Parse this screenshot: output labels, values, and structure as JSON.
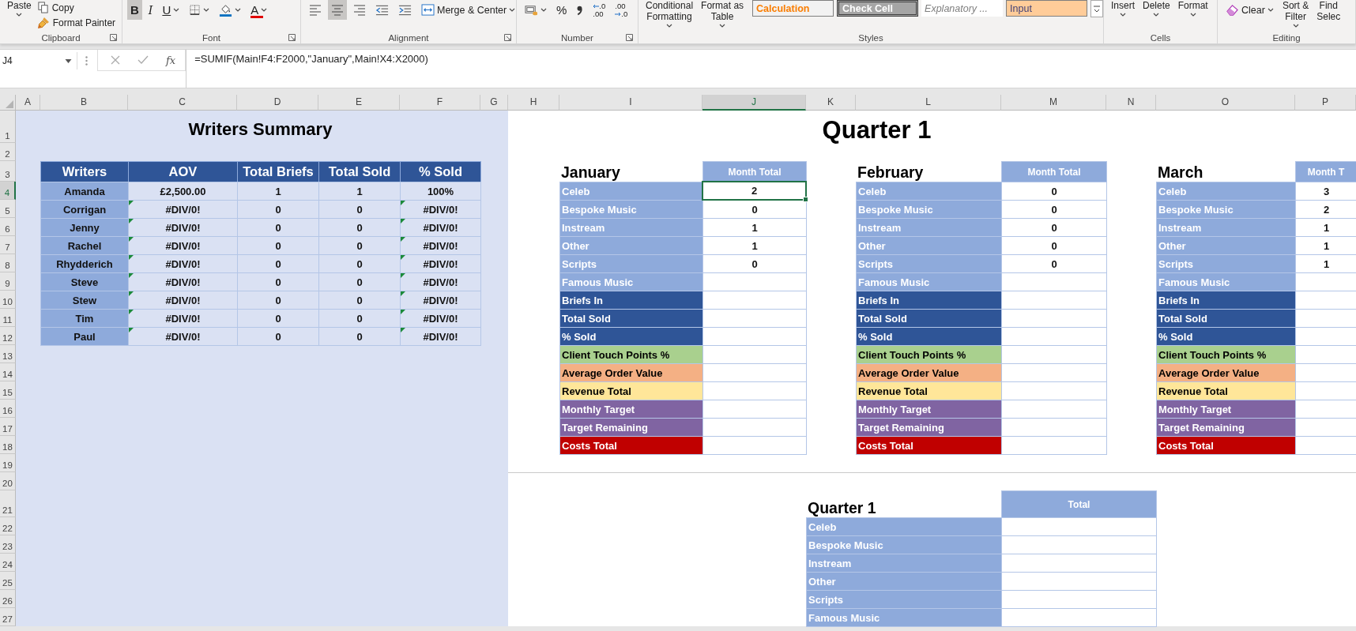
{
  "ribbon": {
    "groups": [
      {
        "label": "Clipboard",
        "items": [
          {
            "kind": "big",
            "lines": [
              "Paste"
            ]
          },
          {
            "kind": "stack",
            "entries": [
              {
                "label": "Copy"
              },
              {
                "label": "Format Painter"
              }
            ]
          }
        ]
      },
      {
        "label": "Font",
        "items": [
          {
            "kind": "tool",
            "glyph": "B",
            "pressed": true
          },
          {
            "kind": "tool",
            "glyph": "I",
            "pressed": false
          },
          {
            "kind": "tool",
            "glyph": "U",
            "pressed": false
          },
          {
            "kind": "tool",
            "pressed": false
          },
          {
            "kind": "tool",
            "pressed": false
          },
          {
            "kind": "tool",
            "glyph": "A",
            "pressed": false
          }
        ]
      },
      {
        "label": "Alignment",
        "items": [
          {
            "kind": "tool",
            "pressed": false
          },
          {
            "kind": "tool",
            "pressed": true
          },
          {
            "kind": "tool",
            "pressed": false
          },
          {
            "kind": "tool",
            "pressed": false
          },
          {
            "kind": "tool",
            "pressed": false
          },
          {
            "kind": "tool",
            "label": "Merge & Center",
            "pressed": false
          }
        ]
      },
      {
        "label": "Number",
        "items": [
          {
            "kind": "tool",
            "pressed": false
          },
          {
            "kind": "tool",
            "glyph": "%",
            "pressed": false
          },
          {
            "kind": "tool",
            "pressed": false
          },
          {
            "kind": "decimal",
            "lines": [
              ".0",
              ".00"
            ]
          },
          {
            "kind": "decimal",
            "lines": [
              ".00",
              ".0"
            ]
          }
        ]
      },
      {
        "label": "Styles",
        "items": [
          {
            "kind": "big",
            "lines": [
              "Conditional",
              "Formatting"
            ]
          },
          {
            "kind": "big",
            "lines": [
              "Format as",
              "Table"
            ]
          },
          {
            "kind": "gallery",
            "cells": [
              "Calculation",
              "Check Cell",
              "Explanatory ...",
              "Input"
            ]
          }
        ]
      },
      {
        "label": "Cells",
        "items": [
          {
            "kind": "big",
            "lines": [
              "Insert"
            ]
          },
          {
            "kind": "big",
            "lines": [
              "Delete"
            ]
          },
          {
            "kind": "big",
            "lines": [
              "Format"
            ]
          }
        ]
      },
      {
        "label": "Editing",
        "items": [
          {
            "kind": "tool",
            "label": "Clear",
            "pressed": false
          },
          {
            "kind": "big",
            "lines": [
              "Sort &",
              "Filter"
            ]
          },
          {
            "kind": "big",
            "lines": [
              "Find",
              "Selec"
            ]
          }
        ]
      }
    ]
  },
  "formula_bar": {
    "name_box": "J4",
    "function_label": "fx",
    "formula": "=SUMIF(Main!F4:F2000,\"January\",Main!X4:X2000)"
  },
  "columns": [
    {
      "letter": "A",
      "selected": false
    },
    {
      "letter": "B",
      "selected": false
    },
    {
      "letter": "C",
      "selected": false
    },
    {
      "letter": "D",
      "selected": false
    },
    {
      "letter": "E",
      "selected": false
    },
    {
      "letter": "F",
      "selected": false
    },
    {
      "letter": "G",
      "selected": false
    },
    {
      "letter": "H",
      "selected": false
    },
    {
      "letter": "I",
      "selected": false
    },
    {
      "letter": "J",
      "selected": true
    },
    {
      "letter": "K",
      "selected": false
    },
    {
      "letter": "L",
      "selected": false
    },
    {
      "letter": "M",
      "selected": false
    },
    {
      "letter": "N",
      "selected": false
    },
    {
      "letter": "O",
      "selected": false
    },
    {
      "letter": "P",
      "selected": false
    }
  ],
  "rows": [
    {
      "label": "1",
      "selected": false
    },
    {
      "label": "2",
      "selected": false
    },
    {
      "label": "3",
      "selected": false
    },
    {
      "label": "4",
      "selected": true
    },
    {
      "label": "5",
      "selected": false
    },
    {
      "label": "6",
      "selected": false
    },
    {
      "label": "7",
      "selected": false
    },
    {
      "label": "8",
      "selected": false
    },
    {
      "label": "9",
      "selected": false
    },
    {
      "label": "10",
      "selected": false
    },
    {
      "label": "11",
      "selected": false
    },
    {
      "label": "12",
      "selected": false
    },
    {
      "label": "13",
      "selected": false
    },
    {
      "label": "14",
      "selected": false
    },
    {
      "label": "15",
      "selected": false
    },
    {
      "label": "16",
      "selected": false
    },
    {
      "label": "17",
      "selected": false
    },
    {
      "label": "18",
      "selected": false
    },
    {
      "label": "19",
      "selected": false
    },
    {
      "label": "20",
      "selected": false
    },
    {
      "label": "21",
      "selected": false
    },
    {
      "label": "22",
      "selected": false
    },
    {
      "label": "23",
      "selected": false
    },
    {
      "label": "24",
      "selected": false
    },
    {
      "label": "25",
      "selected": false
    },
    {
      "label": "26",
      "selected": false
    },
    {
      "label": "27",
      "selected": false
    }
  ],
  "writers_summary": {
    "title": "Writers Summary",
    "columns": [
      "Writers",
      "AOV",
      "Total Briefs",
      "Total Sold",
      "% Sold"
    ],
    "rows": [
      {
        "name": "Amanda",
        "values": [
          "£2,500.00",
          "1",
          "1",
          "100%"
        ],
        "flagged": false
      },
      {
        "name": "Corrigan",
        "values": [
          "#DIV/0!",
          "0",
          "0",
          "#DIV/0!"
        ],
        "flagged": true
      },
      {
        "name": "Jenny",
        "values": [
          "#DIV/0!",
          "0",
          "0",
          "#DIV/0!"
        ],
        "flagged": true
      },
      {
        "name": "Rachel",
        "values": [
          "#DIV/0!",
          "0",
          "0",
          "#DIV/0!"
        ],
        "flagged": true
      },
      {
        "name": "Rhydderich",
        "values": [
          "#DIV/0!",
          "0",
          "0",
          "#DIV/0!"
        ],
        "flagged": true
      },
      {
        "name": "Steve",
        "values": [
          "#DIV/0!",
          "0",
          "0",
          "#DIV/0!"
        ],
        "flagged": true
      },
      {
        "name": "Stew",
        "values": [
          "#DIV/0!",
          "0",
          "0",
          "#DIV/0!"
        ],
        "flagged": true
      },
      {
        "name": "Tim",
        "values": [
          "#DIV/0!",
          "0",
          "0",
          "#DIV/0!"
        ],
        "flagged": true
      },
      {
        "name": "Paul",
        "values": [
          "#DIV/0!",
          "0",
          "0",
          "#DIV/0!"
        ],
        "flagged": true
      }
    ]
  },
  "quarter_title": "Quarter 1",
  "months": [
    {
      "name": "January",
      "header": "Month Total",
      "rows": [
        {
          "label": "Celeb",
          "color": "#8eaadb",
          "value": "2",
          "selected": true
        },
        {
          "label": "Bespoke Music",
          "color": "#8eaadb",
          "value": "0",
          "selected": false
        },
        {
          "label": "Instream",
          "color": "#8eaadb",
          "value": "1",
          "selected": false
        },
        {
          "label": "Other",
          "color": "#8eaadb",
          "value": "1",
          "selected": false
        },
        {
          "label": "Scripts",
          "color": "#8eaadb",
          "value": "0",
          "selected": false
        },
        {
          "label": "Famous Music",
          "color": "#8eaadb",
          "selected": false
        },
        {
          "label": "Briefs In",
          "color": "#2f5597",
          "selected": false
        },
        {
          "label": "Total Sold",
          "color": "#2f5597",
          "selected": false
        },
        {
          "label": "% Sold",
          "color": "#2f5597",
          "selected": false
        },
        {
          "label": "Client Touch Points %",
          "color": "#a9d08e",
          "selected": false
        },
        {
          "label": "Average Order Value",
          "color": "#f4b084",
          "selected": false
        },
        {
          "label": "Revenue Total",
          "color": "#ffe699",
          "selected": false
        },
        {
          "label": "Monthly Target",
          "color": "#8064a2",
          "selected": false
        },
        {
          "label": "Target Remaining",
          "color": "#8064a2",
          "selected": false
        },
        {
          "label": "Costs Total",
          "color": "#c00000",
          "selected": false
        }
      ]
    },
    {
      "name": "February",
      "header": "Month Total",
      "rows": [
        {
          "label": "Celeb",
          "color": "#8eaadb",
          "value": "0",
          "selected": false
        },
        {
          "label": "Bespoke Music",
          "color": "#8eaadb",
          "value": "0",
          "selected": false
        },
        {
          "label": "Instream",
          "color": "#8eaadb",
          "value": "0",
          "selected": false
        },
        {
          "label": "Other",
          "color": "#8eaadb",
          "value": "0",
          "selected": false
        },
        {
          "label": "Scripts",
          "color": "#8eaadb",
          "value": "0",
          "selected": false
        },
        {
          "label": "Famous Music",
          "color": "#8eaadb",
          "selected": false
        },
        {
          "label": "Briefs In",
          "color": "#2f5597",
          "selected": false
        },
        {
          "label": "Total Sold",
          "color": "#2f5597",
          "selected": false
        },
        {
          "label": "% Sold",
          "color": "#2f5597",
          "selected": false
        },
        {
          "label": "Client Touch Points %",
          "color": "#a9d08e",
          "selected": false
        },
        {
          "label": "Average Order Value",
          "color": "#f4b084",
          "selected": false
        },
        {
          "label": "Revenue Total",
          "color": "#ffe699",
          "selected": false
        },
        {
          "label": "Monthly Target",
          "color": "#8064a2",
          "selected": false
        },
        {
          "label": "Target Remaining",
          "color": "#8064a2",
          "selected": false
        },
        {
          "label": "Costs Total",
          "color": "#c00000",
          "selected": false
        }
      ]
    },
    {
      "name": "March",
      "header": "Month T",
      "rows": [
        {
          "label": "Celeb",
          "color": "#8eaadb",
          "value": "3",
          "selected": false
        },
        {
          "label": "Bespoke Music",
          "color": "#8eaadb",
          "value": "2",
          "selected": false
        },
        {
          "label": "Instream",
          "color": "#8eaadb",
          "value": "1",
          "selected": false
        },
        {
          "label": "Other",
          "color": "#8eaadb",
          "value": "1",
          "selected": false
        },
        {
          "label": "Scripts",
          "color": "#8eaadb",
          "value": "1",
          "selected": false
        },
        {
          "label": "Famous Music",
          "color": "#8eaadb",
          "selected": false
        },
        {
          "label": "Briefs In",
          "color": "#2f5597",
          "selected": false
        },
        {
          "label": "Total Sold",
          "color": "#2f5597",
          "selected": false
        },
        {
          "label": "% Sold",
          "color": "#2f5597",
          "selected": false
        },
        {
          "label": "Client Touch Points %",
          "color": "#a9d08e",
          "selected": false
        },
        {
          "label": "Average Order Value",
          "color": "#f4b084",
          "selected": false
        },
        {
          "label": "Revenue Total",
          "color": "#ffe699",
          "selected": false
        },
        {
          "label": "Monthly Target",
          "color": "#8064a2",
          "selected": false
        },
        {
          "label": "Target Remaining",
          "color": "#8064a2",
          "selected": false
        },
        {
          "label": "Costs Total",
          "color": "#c00000",
          "selected": false
        }
      ]
    }
  ],
  "quarter_summary": {
    "name": "Quarter 1",
    "header": "Total",
    "rows": [
      {
        "label": "Celeb",
        "color": "#8eaadb"
      },
      {
        "label": "Bespoke Music",
        "color": "#8eaadb"
      },
      {
        "label": "Instream",
        "color": "#8eaadb"
      },
      {
        "label": "Other",
        "color": "#8eaadb"
      },
      {
        "label": "Scripts",
        "color": "#8eaadb"
      },
      {
        "label": "Famous Music",
        "color": "#8eaadb"
      }
    ]
  }
}
